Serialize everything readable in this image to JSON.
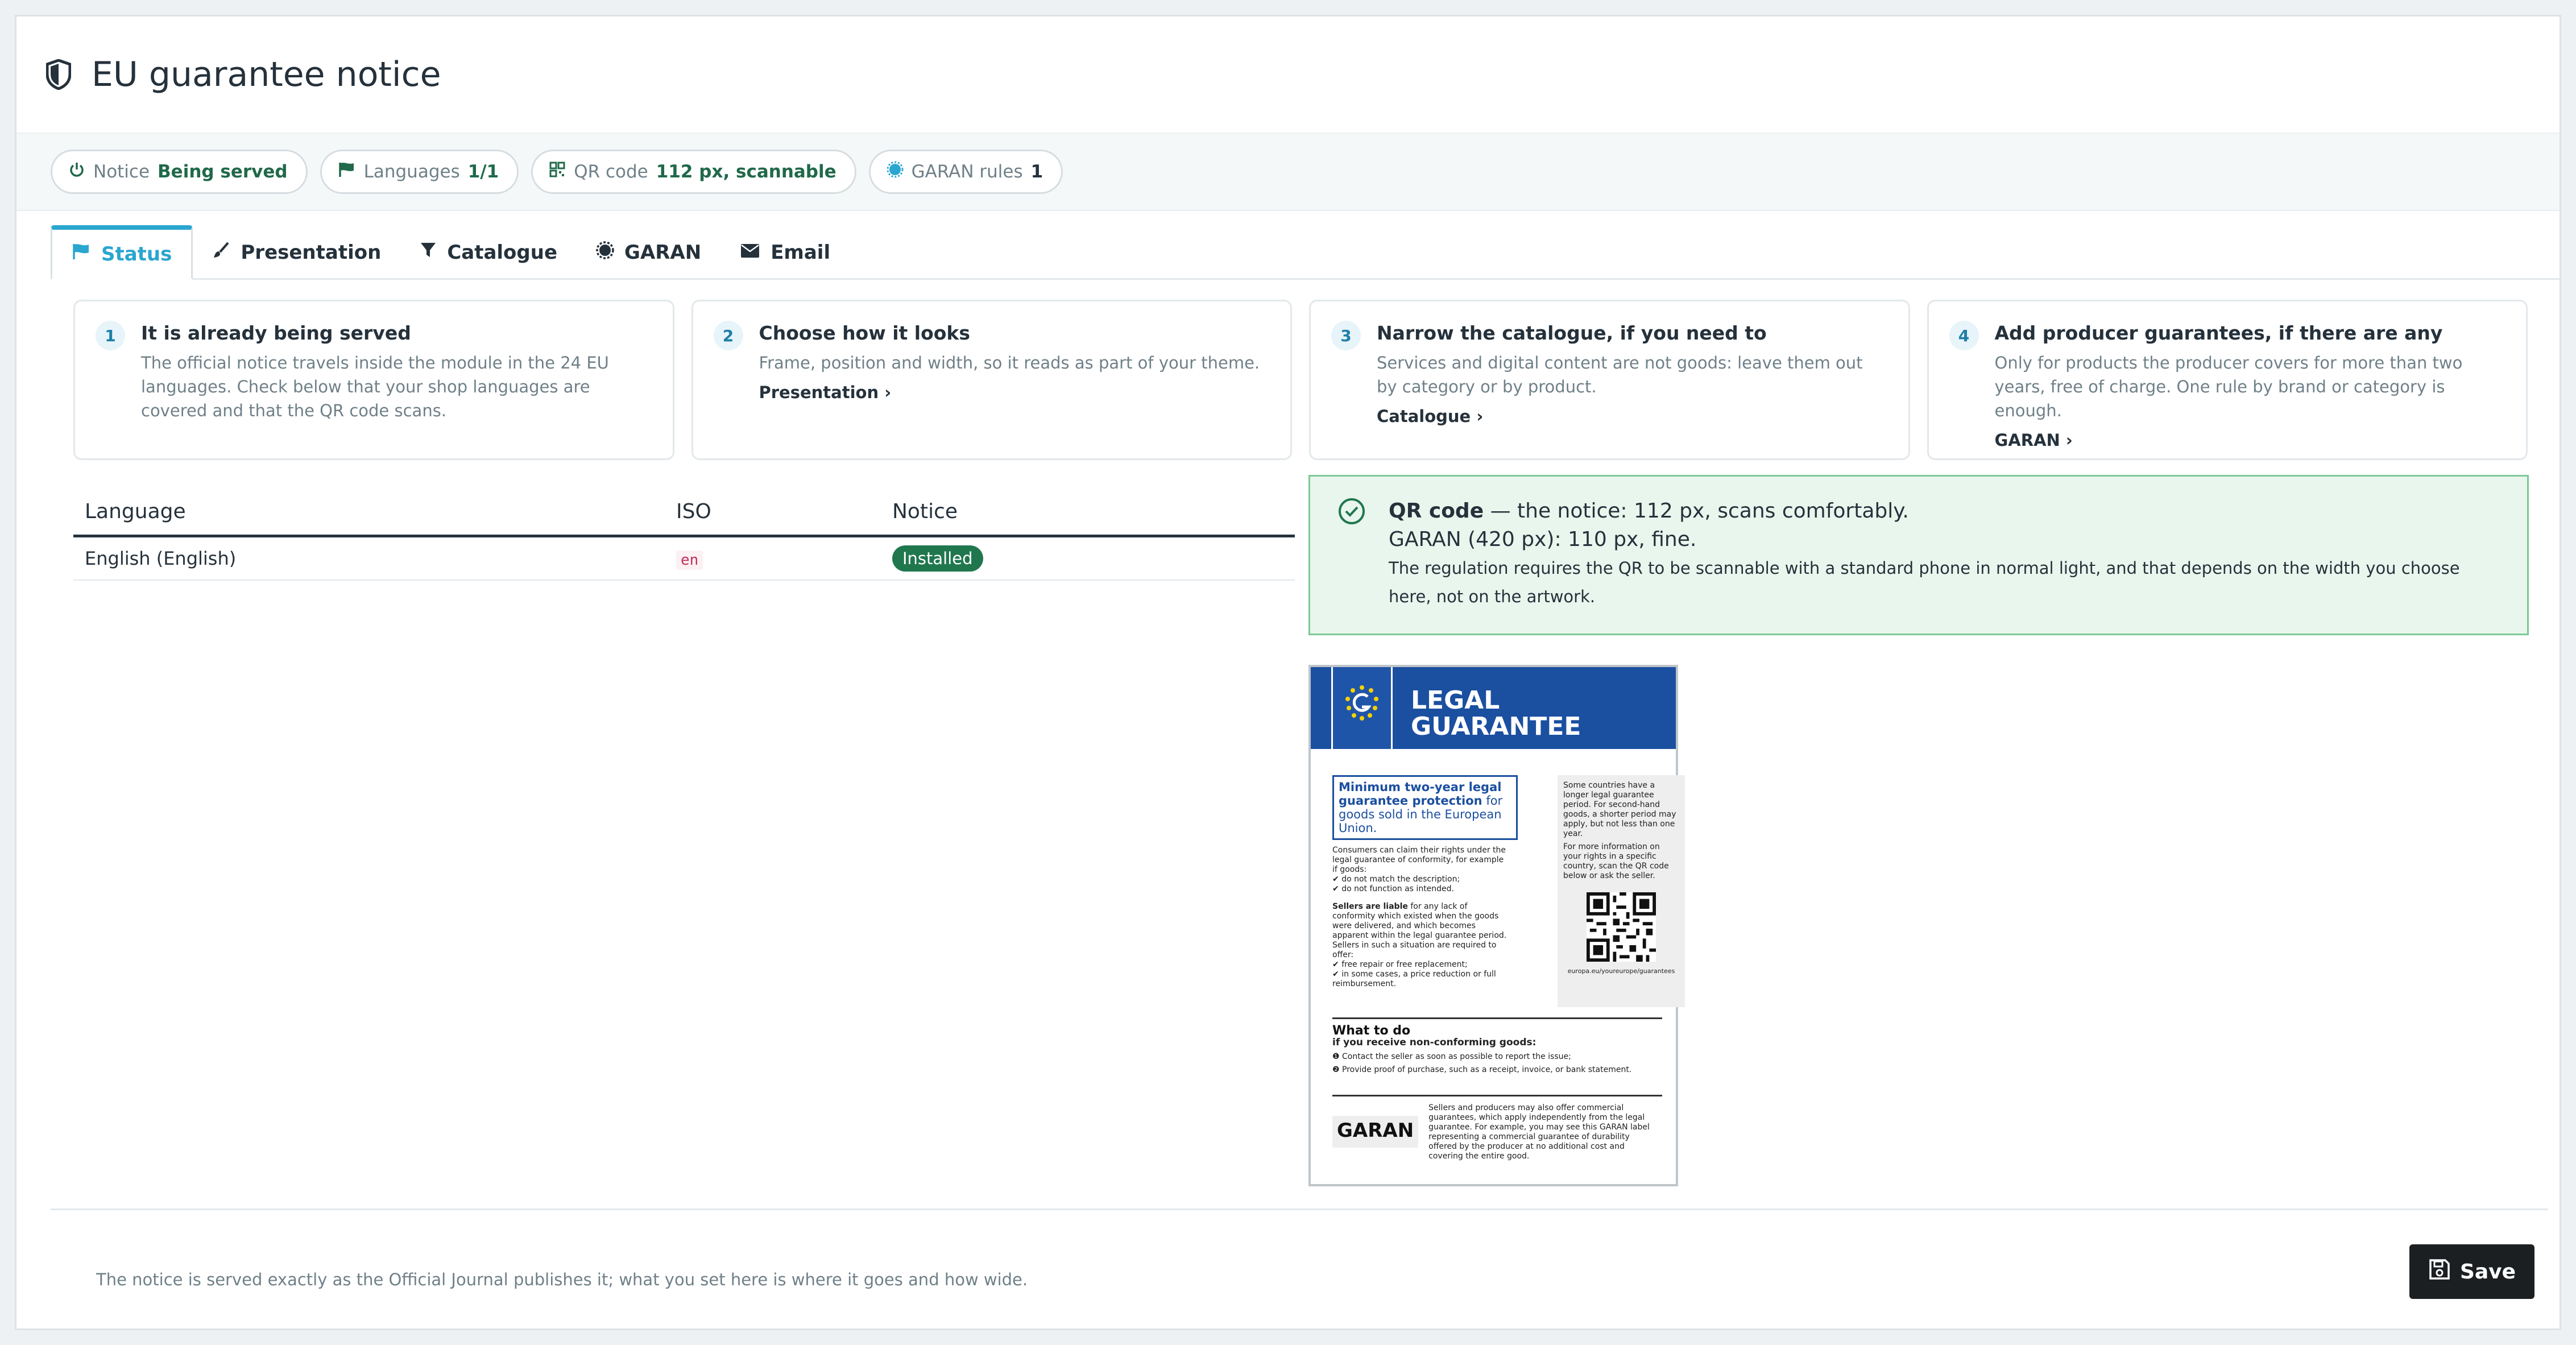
{
  "header": {
    "title": "EU guarantee notice"
  },
  "kpis": [
    {
      "label": "Notice",
      "value": "Being served"
    },
    {
      "label": "Languages",
      "value": "1/1"
    },
    {
      "label": "QR code",
      "value": "112 px, scannable"
    },
    {
      "label": "GARAN rules",
      "value": "1"
    }
  ],
  "tabs": [
    "Status",
    "Presentation",
    "Catalogue",
    "GARAN",
    "Email"
  ],
  "steps": [
    {
      "num": "1",
      "title": "It is already being served",
      "text": "The official notice travels inside the module in the 24 EU languages. Check below that your shop languages are covered and that the QR code scans.",
      "link": ""
    },
    {
      "num": "2",
      "title": "Choose how it looks",
      "text": "Frame, position and width, so it reads as part of your theme.",
      "link": "Presentation ›"
    },
    {
      "num": "3",
      "title": "Narrow the catalogue, if you need to",
      "text": "Services and digital content are not goods: leave them out by category or by product.",
      "link": "Catalogue ›"
    },
    {
      "num": "4",
      "title": "Add producer guarantees, if there are any",
      "text": "Only for products the producer covers for more than two years, free of charge. One rule by brand or category is enough.",
      "link": "GARAN ›"
    }
  ],
  "table": {
    "headers": [
      "Language",
      "ISO",
      "Notice"
    ],
    "rows": [
      {
        "language": "English (English)",
        "iso": "en",
        "notice": "Installed"
      }
    ]
  },
  "qr_alert": {
    "strong": "QR code",
    "line1": " — the notice: 112 px, scans comfortably.",
    "line2": "GARAN (420 px): 110 px, fine.",
    "line3": "The regulation requires the QR to be scannable with a standard phone in normal light, and that depends on the width you choose here, not on the artwork."
  },
  "poster": {
    "heading1": "LEGAL",
    "heading2": "GUARANTEE",
    "box_strong": "Minimum two-year legal guarantee protection",
    "box_rest": " for goods sold in the European Union.",
    "consumers": "Consumers can claim their rights under the legal guarantee of conformity, for example if goods:",
    "bullet1": "do not match the description;",
    "bullet2": "do not function as intended.",
    "sellers_strong": "Sellers are liable",
    "sellers_rest": " for any lack of conformity which existed when the goods were delivered, and which becomes apparent within the legal guarantee period. Sellers in such a situation are required to offer:",
    "offer1": "free repair or free replacement;",
    "offer2": "in some cases, a price reduction or full reimbursement.",
    "grey1": "Some countries have a longer legal guarantee period. For second-hand goods, a shorter period may apply, but not less than one year.",
    "grey2": "For more information on your rights in a specific country, scan the QR code below or ask the seller.",
    "url": "europa.eu/youreurope/guarantees",
    "what_title": "What to do",
    "what_sub": "if you receive non-conforming goods:",
    "step1": "Contact the seller as soon as possible to report the issue;",
    "step2": "Provide proof of purchase, such as a receipt, invoice, or bank statement.",
    "garan_logo": "GARAN",
    "garan_text": "Sellers and producers may also offer commercial guarantees, which apply independently from the legal guarantee. For example, you may see this GARAN label representing a commercial guarantee of durability offered by the producer at no additional cost and covering the entire good."
  },
  "footer": {
    "note": "The notice is served exactly as the Official Journal publishes it; what you set here is where it goes and how wide.",
    "save_label": "Save"
  },
  "colors": {
    "accent": "#2aa6cf",
    "success": "#20774e",
    "dark": "#1b1f22",
    "eu_blue": "#1b4fa0"
  }
}
